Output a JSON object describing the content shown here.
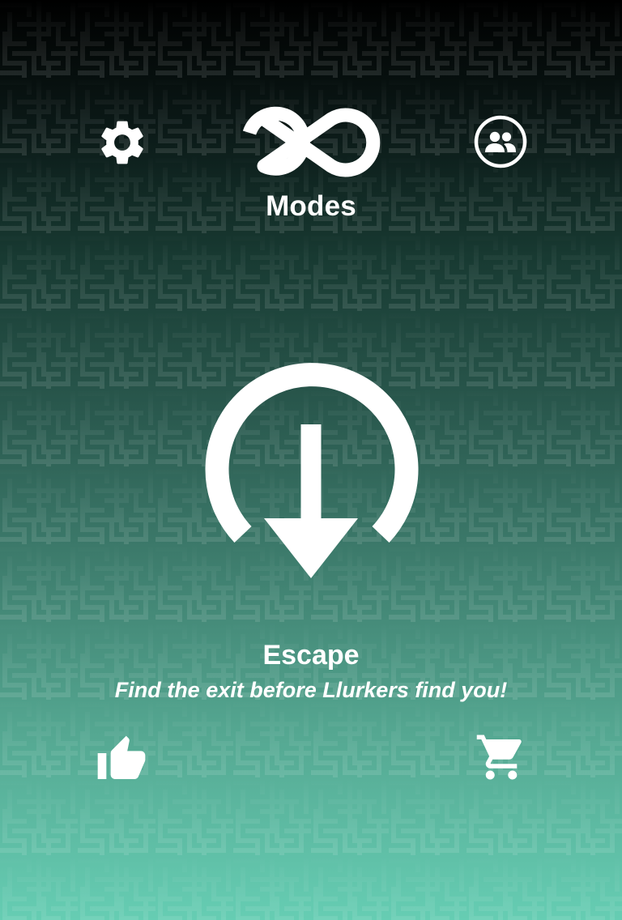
{
  "header": {
    "title": "Modes",
    "settings_icon": "gear-icon",
    "modes_icon": "infinity-icon",
    "social_icon": "group-icon"
  },
  "mode": {
    "name": "Escape",
    "description": "Find the exit before Llurkers find you!",
    "icon": "escape-down-arrow-icon"
  },
  "footer": {
    "like_icon": "thumbs-up-icon",
    "shop_icon": "shopping-cart-icon"
  },
  "colors": {
    "gradient_top": "#000000",
    "gradient_bottom": "#66cdb3",
    "foreground": "#ffffff"
  }
}
